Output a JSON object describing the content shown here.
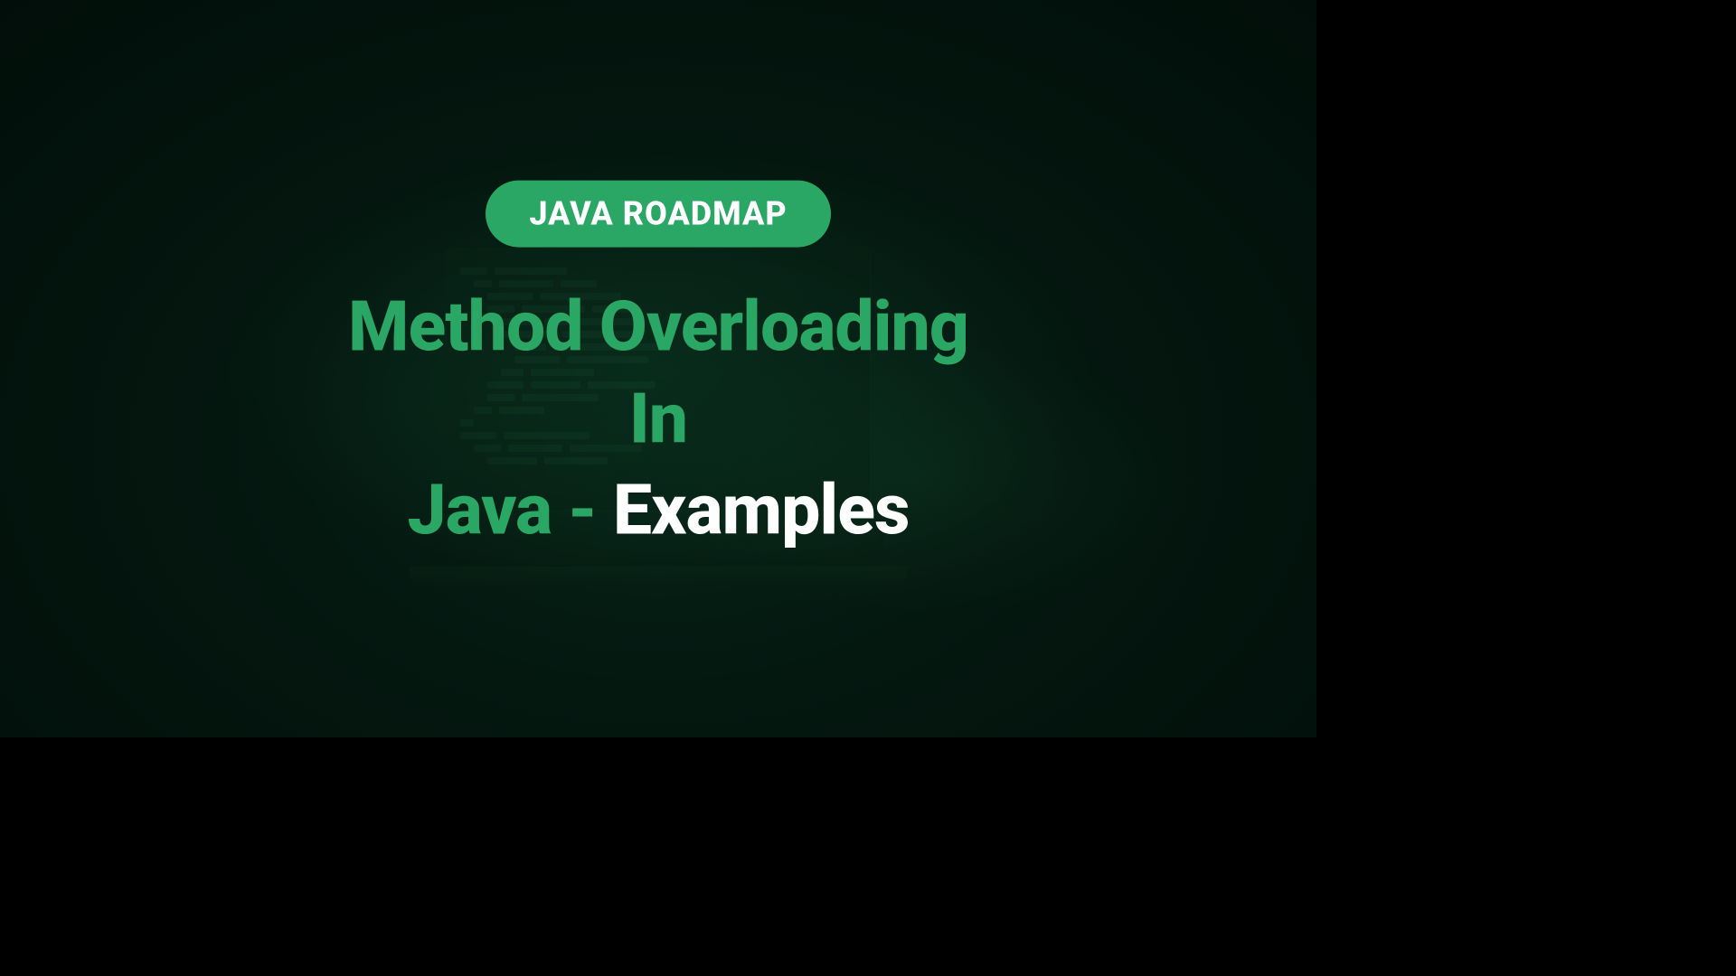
{
  "badge": {
    "label": "JAVA ROADMAP"
  },
  "title": {
    "line1": "Method Overloading In",
    "line2_green": "Java - ",
    "line2_white": "Examples"
  },
  "colors": {
    "accent": "#2aa765"
  }
}
